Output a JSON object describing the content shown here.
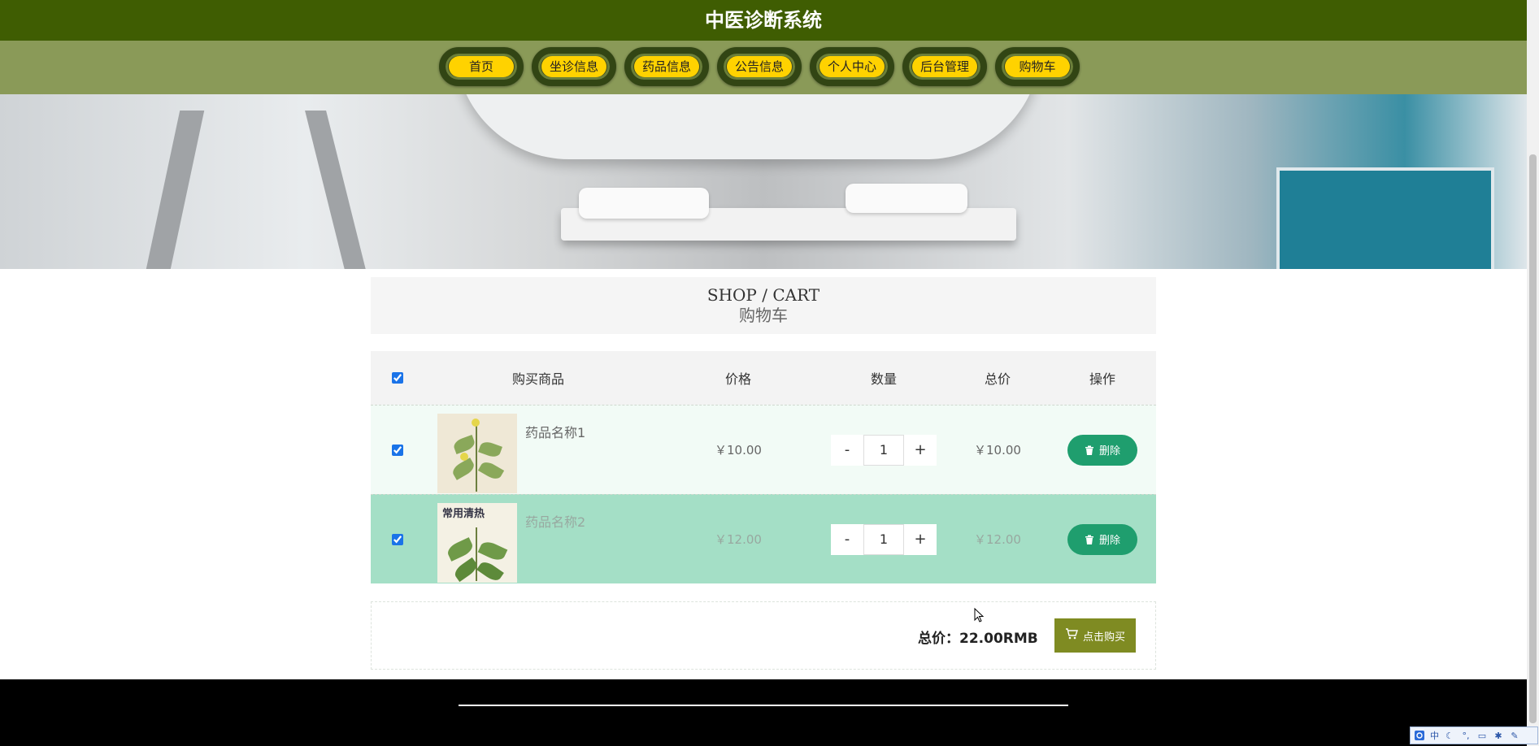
{
  "header": {
    "title": "中医诊断系统"
  },
  "nav": {
    "items": [
      {
        "label": "首页"
      },
      {
        "label": "坐诊信息"
      },
      {
        "label": "药品信息"
      },
      {
        "label": "公告信息"
      },
      {
        "label": "个人中心"
      },
      {
        "label": "后台管理"
      },
      {
        "label": "购物车"
      }
    ]
  },
  "carousel": {
    "active_index": 1,
    "slide_count": 3
  },
  "section": {
    "title_en": "SHOP / CART",
    "title_cn": "购物车"
  },
  "cart": {
    "columns": {
      "goods": "购买商品",
      "price": "价格",
      "qty": "数量",
      "total": "总价",
      "op": "操作"
    },
    "select_all": true,
    "minus_label": "-",
    "plus_label": "+",
    "delete_label": "删除",
    "items": [
      {
        "name": "药品名称1",
        "price": "￥10.00",
        "qty": "1",
        "total": "￥10.00",
        "checked": true
      },
      {
        "name": "药品名称2",
        "price": "￥12.00",
        "qty": "1",
        "total": "￥12.00",
        "checked": true,
        "thumb_caption": "常用清热"
      }
    ]
  },
  "summary": {
    "total_text": "总价：22.00RMB",
    "buy_label": "点击购买"
  },
  "taskbar": {
    "ime_label": "中"
  },
  "colors": {
    "header_bg": "#3f5d02",
    "nav_bg": "#8a9a58",
    "nav_pill": "#ffd200",
    "delete_btn": "#1f9e6e",
    "buy_btn": "#7f8b22",
    "row_highlight": "#a4dfc6"
  }
}
